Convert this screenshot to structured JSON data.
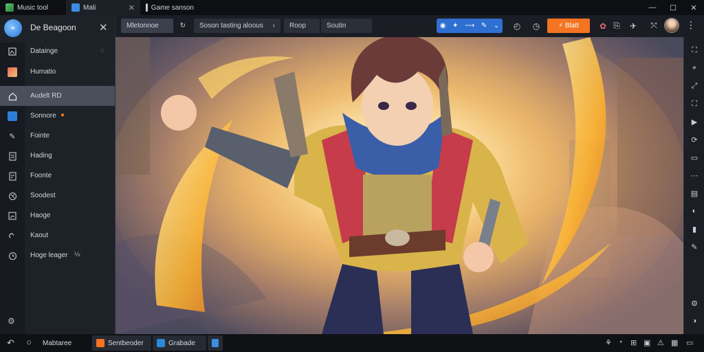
{
  "titlebar": {
    "app_label": "Music tool",
    "tab_active_label": "Mali",
    "tab_third_label": "Game sanson",
    "close_glyph": "✕",
    "window_controls": [
      "—",
      "☐",
      "✕"
    ]
  },
  "sidebar": {
    "title": "De Beagoon",
    "avatar_glyph": "≈",
    "close_glyph": "✕",
    "items": [
      {
        "label": "Datainge",
        "icon": "image-icon",
        "extra": "◌"
      },
      {
        "label": "Humatio",
        "icon": "game-thumbnail-icon",
        "extra": ""
      },
      {
        "label": "Audelt RD",
        "icon": "home-icon",
        "extra": ""
      },
      {
        "label": "Sonnore",
        "icon": "app-thumbnail-icon",
        "extra": "●"
      },
      {
        "label": "Fointe",
        "icon": "pen-icon",
        "extra": ""
      },
      {
        "label": "Hading",
        "icon": "document-icon",
        "extra": ""
      },
      {
        "label": "Foonte",
        "icon": "document-icon",
        "extra": ""
      },
      {
        "label": "Soodest",
        "icon": "globe-icon",
        "extra": ""
      },
      {
        "label": "Haoge",
        "icon": "chart-icon",
        "extra": ""
      },
      {
        "label": "Kaout",
        "icon": "link-icon",
        "extra": ""
      },
      {
        "label": "Hoge leager",
        "icon": "clock-icon",
        "extra": "⅛"
      }
    ],
    "bottom_icon_glyph": "⚙"
  },
  "toolbar": {
    "tab1_label": "Mletonnoe",
    "tab2_label": "Soson tasting aloous",
    "tab2_extra": "›",
    "tab3_label": "Roop",
    "tab4_label": "Soutin",
    "blue_group": [
      "◉",
      "✦",
      "⟶",
      "✎",
      "⌄"
    ],
    "orange_label": "⚡ Blatt",
    "icons": [
      "↻",
      "◴",
      "✿",
      "⎘",
      "⤧"
    ],
    "menu_glyph": "⋮"
  },
  "rightbar": {
    "icons": [
      "⛶",
      "⌖",
      "⤢",
      "⛶",
      "▶",
      "⟳",
      "▭",
      "⋯",
      "▤",
      "◐",
      "▮",
      "✎",
      "⚙",
      "◑"
    ]
  },
  "taskbar": {
    "back_glyph": "↶",
    "home_glyph": "○",
    "start_label": "Mabtaree",
    "tasks": [
      {
        "label": "Sentbeoder",
        "color": "#f47421"
      },
      {
        "label": "Grabade",
        "color": "#2f8ad6"
      },
      {
        "label": "",
        "color": "#3a8fe0"
      }
    ],
    "tray_icons": [
      "⚘",
      "◔",
      "⊞",
      "▣",
      "⚠",
      "▦"
    ]
  }
}
